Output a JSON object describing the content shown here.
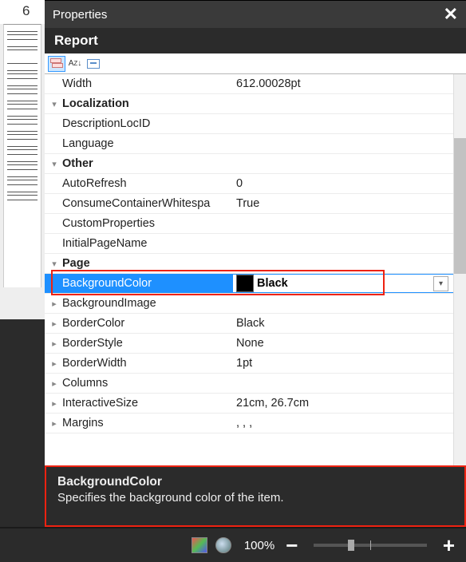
{
  "ruler": {
    "tick": "6"
  },
  "panel": {
    "title": "Properties",
    "report_label": "Report"
  },
  "grid": {
    "rows": [
      {
        "kind": "prop",
        "exp": "",
        "name": "Width",
        "value": "612.00028pt"
      },
      {
        "kind": "cat",
        "exp": "v",
        "name": "Localization",
        "value": ""
      },
      {
        "kind": "prop",
        "exp": "",
        "name": "DescriptionLocID",
        "value": ""
      },
      {
        "kind": "prop",
        "exp": "",
        "name": "Language",
        "value": ""
      },
      {
        "kind": "cat",
        "exp": "v",
        "name": "Other",
        "value": ""
      },
      {
        "kind": "prop",
        "exp": "",
        "name": "AutoRefresh",
        "value": "0"
      },
      {
        "kind": "prop",
        "exp": "",
        "name": "ConsumeContainerWhitespa",
        "value": "True"
      },
      {
        "kind": "prop",
        "exp": "",
        "name": "CustomProperties",
        "value": ""
      },
      {
        "kind": "prop",
        "exp": "",
        "name": "InitialPageName",
        "value": ""
      },
      {
        "kind": "cat",
        "exp": "v",
        "name": "Page",
        "value": ""
      },
      {
        "kind": "sel",
        "exp": "",
        "name": "BackgroundColor",
        "value": "Black",
        "swatch": "#000000"
      },
      {
        "kind": "prop",
        "exp": ">",
        "name": "BackgroundImage",
        "value": ""
      },
      {
        "kind": "prop",
        "exp": ">",
        "name": "BorderColor",
        "value": "Black"
      },
      {
        "kind": "prop",
        "exp": ">",
        "name": "BorderStyle",
        "value": "None"
      },
      {
        "kind": "prop",
        "exp": ">",
        "name": "BorderWidth",
        "value": "1pt"
      },
      {
        "kind": "prop",
        "exp": ">",
        "name": "Columns",
        "value": ""
      },
      {
        "kind": "prop",
        "exp": ">",
        "name": "InteractiveSize",
        "value": "21cm, 26.7cm"
      },
      {
        "kind": "prop",
        "exp": ">",
        "name": "Margins",
        "value": ", , ,"
      }
    ]
  },
  "description": {
    "title": "BackgroundColor",
    "text": "Specifies the background color of the item."
  },
  "status": {
    "zoom": "100%"
  }
}
